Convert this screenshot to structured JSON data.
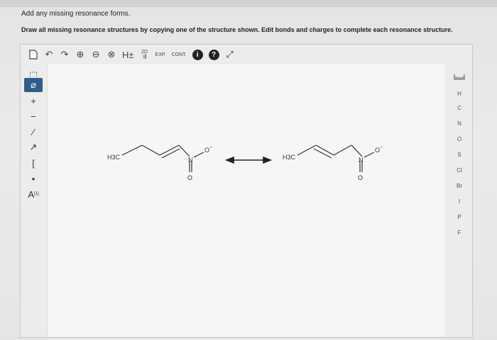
{
  "instructions": {
    "line1": "Add any missing resonance forms.",
    "line2": "Draw all missing resonance structures by copying one of the structure shown. Edit bonds and charges to complete each resonance structure."
  },
  "toolbar": {
    "clear_icon": "new-document-icon",
    "undo": "↶",
    "redo": "↷",
    "zoom_in": "⊕",
    "zoom_out": "⊖",
    "reset": "⊗",
    "hydrogen": "H±",
    "btn_2d_top": "2D",
    "btn_2d_bottom": "⇶",
    "exp": "EXP.",
    "cont": "CONT.",
    "info": "i",
    "help": "?",
    "expand": "⤢"
  },
  "left_tools": {
    "select": "⬚",
    "eraser": "⌀",
    "plus": "+",
    "minus": "−",
    "bond": "⁄",
    "chain": "↗",
    "bracket": "[",
    "dot": "•",
    "atom_label": "A",
    "atom_label_sup": "[1]"
  },
  "right_tools": {
    "periodic_icon": "periodic-table-icon",
    "elements": [
      "H",
      "C",
      "N",
      "O",
      "S",
      "Cl",
      "Br",
      "I",
      "P",
      "F"
    ]
  },
  "structures": {
    "left": {
      "methyl": "H3C",
      "nitrogen": "N",
      "n_charge": "+",
      "oxygen_top": "O",
      "o_charge": "−",
      "oxygen_bottom": "O"
    },
    "right": {
      "methyl": "H3C",
      "nitrogen": "N",
      "n_charge": "+",
      "oxygen_top": "O",
      "o_charge": "−",
      "oxygen_bottom": "O"
    },
    "arrow": "resonance-double-arrow"
  }
}
